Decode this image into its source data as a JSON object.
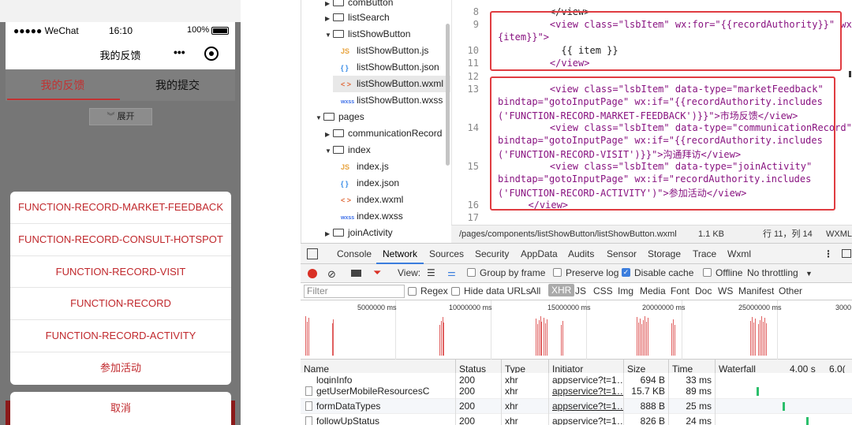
{
  "phone": {
    "carrier": "●●●●● WeChat",
    "time": "16:10",
    "battery": "100%",
    "nav_title": "我的反馈",
    "more_icon": "•••",
    "tabs": [
      {
        "label": "我的反馈",
        "active": true
      },
      {
        "label": "我的提交",
        "active": false
      }
    ],
    "expand_label": "展开",
    "action_sheet": [
      "FUNCTION-RECORD-MARKET-FEEDBACK",
      "FUNCTION-RECORD-CONSULT-HOTSPOT",
      "FUNCTION-RECORD-VISIT",
      "FUNCTION-RECORD",
      "FUNCTION-RECORD-ACTIVITY",
      "参加活动"
    ],
    "cancel_label": "取消"
  },
  "tree": {
    "items": [
      {
        "label": "comButton",
        "type": "folder",
        "state": "collapsed"
      },
      {
        "label": "listSearch",
        "type": "folder",
        "state": "collapsed"
      },
      {
        "label": "listShowButton",
        "type": "folder",
        "state": "open"
      },
      {
        "label": "listShowButton.js",
        "type": "js",
        "icon": "JS"
      },
      {
        "label": "listShowButton.json",
        "type": "json",
        "icon": "{ }"
      },
      {
        "label": "listShowButton.wxml",
        "type": "wxml",
        "icon": "< >"
      },
      {
        "label": "listShowButton.wxss",
        "type": "wxss",
        "icon": "wxss"
      },
      {
        "label": "pages",
        "type": "folder",
        "state": "open"
      },
      {
        "label": "communicationRecord",
        "type": "folder",
        "state": "collapsed"
      },
      {
        "label": "index",
        "type": "folder",
        "state": "open"
      },
      {
        "label": "index.js",
        "type": "js",
        "icon": "JS"
      },
      {
        "label": "index.json",
        "type": "json",
        "icon": "{ }"
      },
      {
        "label": "index.wxml",
        "type": "wxml",
        "icon": "< >"
      },
      {
        "label": "index.wxss",
        "type": "wxss",
        "icon": "wxss"
      },
      {
        "label": "joinActivity",
        "type": "folder",
        "state": "collapsed"
      }
    ]
  },
  "editor": {
    "line_numbers": [
      "8",
      "9",
      "",
      "10",
      "11",
      "12",
      "13",
      "",
      "",
      "14",
      "",
      "",
      "15",
      "",
      "",
      "16",
      "17"
    ],
    "lines": [
      "    </view>",
      "    <view class=\"lsbItem\" wx:for=\"{{recordAuthority}}\" wx:key=\"{",
      "{item}}\">",
      "      {{ item }}",
      "    </view>",
      "",
      "    <view class=\"lsbItem\" data-type=\"marketFeedback\"",
      "bindtap=\"gotoInputPage\" wx:if=\"{{recordAuthority.includes",
      "('FUNCTION-RECORD-MARKET-FEEDBACK')}}\">市场反馈</view>",
      "    <view class=\"lsbItem\" data-type=\"communicationRecord\"",
      "bindtap=\"gotoInputPage\" wx:if=\"{{recordAuthority.includes",
      "('FUNCTION-RECORD-VISIT')}}\">沟通拜访</view>",
      "    <view class=\"lsbItem\" data-type=\"joinActivity\"",
      "bindtap=\"gotoInputPage\" wx:if=\"recordAuthority.includes",
      "('FUNCTION-RECORD-ACTIVITY')\">参加活动</view>",
      "  </view>",
      ""
    ],
    "path": "/pages/components/listShowButton/listShowButton.wxml",
    "size": "1.1 KB",
    "cursor": "行 11，列 14",
    "lang": "WXML"
  },
  "devtools": {
    "tabs": [
      "Console",
      "Network",
      "Sources",
      "Security",
      "AppData",
      "Audits",
      "Sensor",
      "Storage",
      "Trace",
      "Wxml"
    ],
    "active_tab": "Network",
    "toolbar": {
      "view_label": "View:",
      "group_by_frame": "Group by frame",
      "preserve_log": "Preserve log",
      "disable_cache": "Disable cache",
      "offline": "Offline",
      "throttling": "No throttling"
    },
    "filter": {
      "placeholder": "Filter",
      "regex": "Regex",
      "hide_data_urls": "Hide data URLs",
      "types": [
        "All",
        "XHR",
        "JS",
        "CSS",
        "Img",
        "Media",
        "Font",
        "Doc",
        "WS",
        "Manifest",
        "Other"
      ],
      "active_type": "XHR"
    },
    "timeline_ticks": [
      "5000000 ms",
      "10000000 ms",
      "15000000 ms",
      "20000000 ms",
      "25000000 ms",
      "3000"
    ],
    "columns": [
      "Name",
      "Status",
      "Type",
      "Initiator",
      "Size",
      "Time",
      "Waterfall",
      "4.00 s",
      "6.0("
    ],
    "rows": [
      {
        "name": "loginInfo",
        "status": "200",
        "type": "xhr",
        "initiator": "appservice?t=1…",
        "size": "694 B",
        "time": "33 ms"
      },
      {
        "name": "getUserMobileResourcesC",
        "status": "200",
        "type": "xhr",
        "initiator": "appservice?t=1…",
        "size": "15.7 KB",
        "time": "89 ms"
      },
      {
        "name": "formDataTypes",
        "status": "200",
        "type": "xhr",
        "initiator": "appservice?t=1…",
        "size": "888 B",
        "time": "25 ms"
      },
      {
        "name": "followUpStatus",
        "status": "200",
        "type": "xhr",
        "initiator": "appservice?t=1…",
        "size": "826 B",
        "time": "24 ms"
      }
    ]
  }
}
